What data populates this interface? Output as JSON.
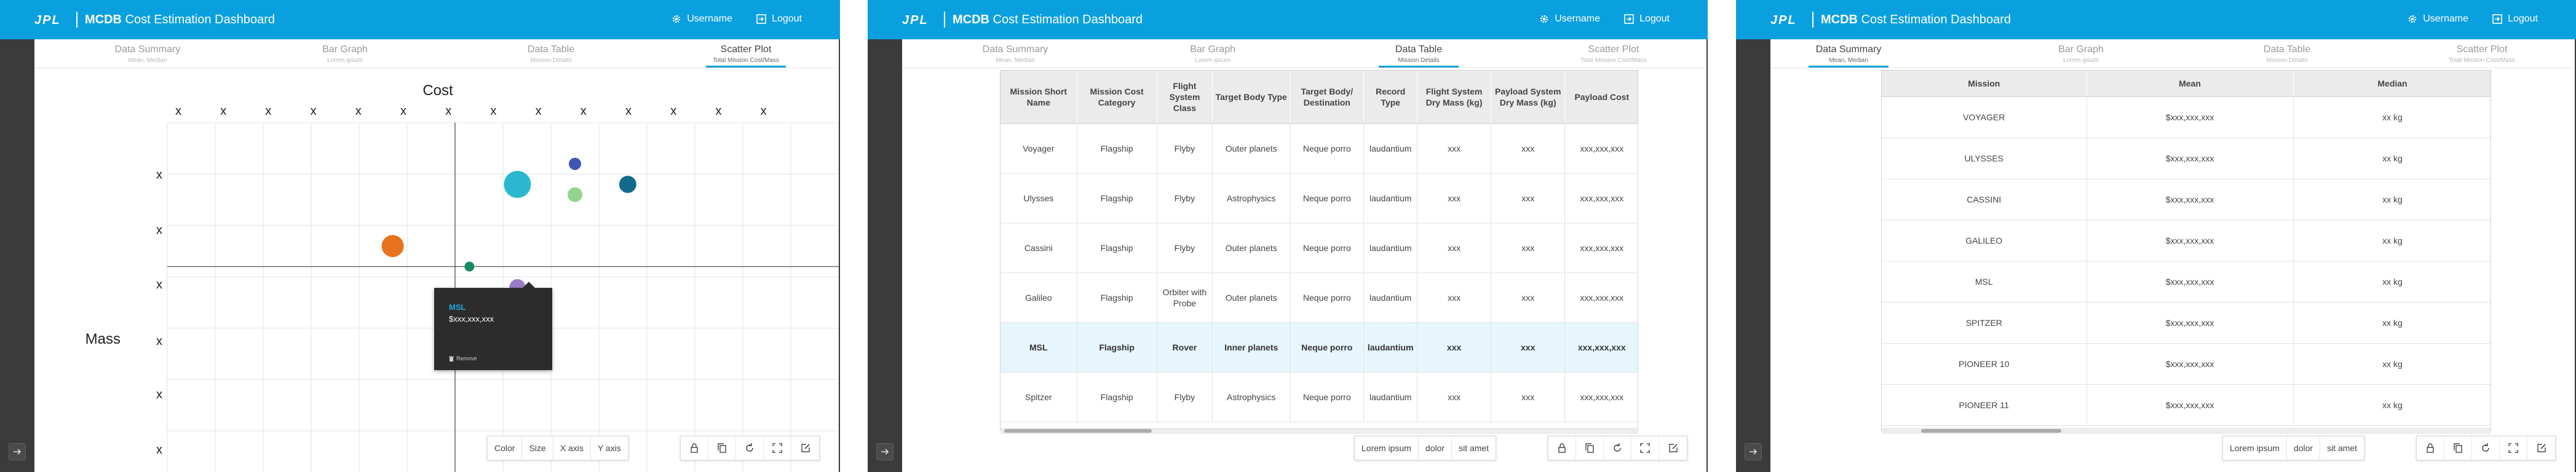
{
  "app": {
    "title_bold": "MCDB",
    "title_rest": " Cost Estimation Dashboard",
    "username": "Username",
    "logout": "Logout",
    "logo": "JPL"
  },
  "tabs": [
    {
      "label": "Data Summary",
      "sub": "Mean, Median"
    },
    {
      "label": "Bar Graph",
      "sub": "Lorem ipsum"
    },
    {
      "label": "Data Table",
      "sub": "Mission Details"
    },
    {
      "label": "Scatter Plot",
      "sub": "Total Mission Cost/Mass"
    }
  ],
  "chart_data": {
    "type": "scatter",
    "title": "Cost",
    "ylabel": "Mass",
    "x_tick_labels": [
      "x",
      "x",
      "x",
      "x",
      "x",
      "x",
      "x",
      "x",
      "x",
      "x",
      "x",
      "x",
      "x",
      "x"
    ],
    "y_tick_labels": [
      "x",
      "x",
      "x",
      "x",
      "x",
      "x"
    ],
    "points": [
      {
        "x": 6.3,
        "y": 4.0,
        "size": 8,
        "color": "#1a8a63"
      },
      {
        "x": 4.7,
        "y": 4.4,
        "size": 18,
        "color": "#e8731e"
      },
      {
        "x": 7.3,
        "y": 5.6,
        "size": 22,
        "color": "#2bb8cf"
      },
      {
        "x": 8.5,
        "y": 5.4,
        "size": 12,
        "color": "#94d38e"
      },
      {
        "x": 8.5,
        "y": 6.0,
        "size": 10,
        "color": "#3f56b3"
      },
      {
        "x": 9.6,
        "y": 5.6,
        "size": 14,
        "color": "#126a8a"
      },
      {
        "x": 7.3,
        "y": 3.6,
        "size": 13,
        "color": "#9b7dc6"
      }
    ]
  },
  "tooltip": {
    "name": "MSL",
    "value": "$xxx,xxx,xxx",
    "remove": "Remove"
  },
  "scatter_controls": [
    "Color",
    "Size",
    "X axis",
    "Y axis"
  ],
  "table_controls": [
    "Lorem ipsum",
    "dolor",
    "sit amet"
  ],
  "summary_controls": [
    "Lorem ipsum",
    "dolor",
    "sit amet"
  ],
  "action_icons": [
    "lock-icon",
    "copy-icon",
    "refresh-icon",
    "fullscreen-icon",
    "edit-icon"
  ],
  "data_table": {
    "headers": [
      "Mission Short Name",
      "Mission Cost Category",
      "Flight System Class",
      "Target Body Type",
      "Target Body/ Destination",
      "Record Type",
      "Flight System Dry Mass (kg)",
      "Payload System Dry Mass (kg)",
      "Payload Cost"
    ],
    "rows": [
      [
        "Voyager",
        "Flagship",
        "Flyby",
        "Outer planets",
        "Neque porro",
        "laudantium",
        "xxx",
        "xxx",
        "xxx,xxx,xxx"
      ],
      [
        "Ulysses",
        "Flagship",
        "Flyby",
        "Astrophysics",
        "Neque porro",
        "laudantium",
        "xxx",
        "xxx",
        "xxx,xxx,xxx"
      ],
      [
        "Cassini",
        "Flagship",
        "Flyby",
        "Outer planets",
        "Neque porro",
        "laudantium",
        "xxx",
        "xxx",
        "xxx,xxx,xxx"
      ],
      [
        "Galileo",
        "Flagship",
        "Orbiter with Probe",
        "Outer planets",
        "Neque porro",
        "laudantium",
        "xxx",
        "xxx",
        "xxx,xxx,xxx"
      ],
      [
        "MSL",
        "Flagship",
        "Rover",
        "Inner planets",
        "Neque porro",
        "laudantium",
        "xxx",
        "xxx",
        "xxx,xxx,xxx"
      ],
      [
        "Spitzer",
        "Flagship",
        "Flyby",
        "Astrophysics",
        "Neque porro",
        "laudantium",
        "xxx",
        "xxx",
        "xxx,xxx,xxx"
      ]
    ],
    "highlight_row": 4
  },
  "summary_table": {
    "headers": [
      "Mission",
      "Mean",
      "Median"
    ],
    "rows": [
      [
        "VOYAGER",
        "$xxx,xxx,xxx",
        "xx kg"
      ],
      [
        "ULYSSES",
        "$xxx,xxx,xxx",
        "xx kg"
      ],
      [
        "CASSINI",
        "$xxx,xxx,xxx",
        "xx kg"
      ],
      [
        "GALILEO",
        "$xxx,xxx,xxx",
        "xx kg"
      ],
      [
        "MSL",
        "$xxx,xxx,xxx",
        "xx kg"
      ],
      [
        "SPITZER",
        "$xxx,xxx,xxx",
        "xx kg"
      ],
      [
        "PIONEER 10",
        "$xxx,xxx,xxx",
        "xx kg"
      ],
      [
        "PIONEER 11",
        "$xxx,xxx,xxx",
        "xx kg"
      ]
    ]
  }
}
